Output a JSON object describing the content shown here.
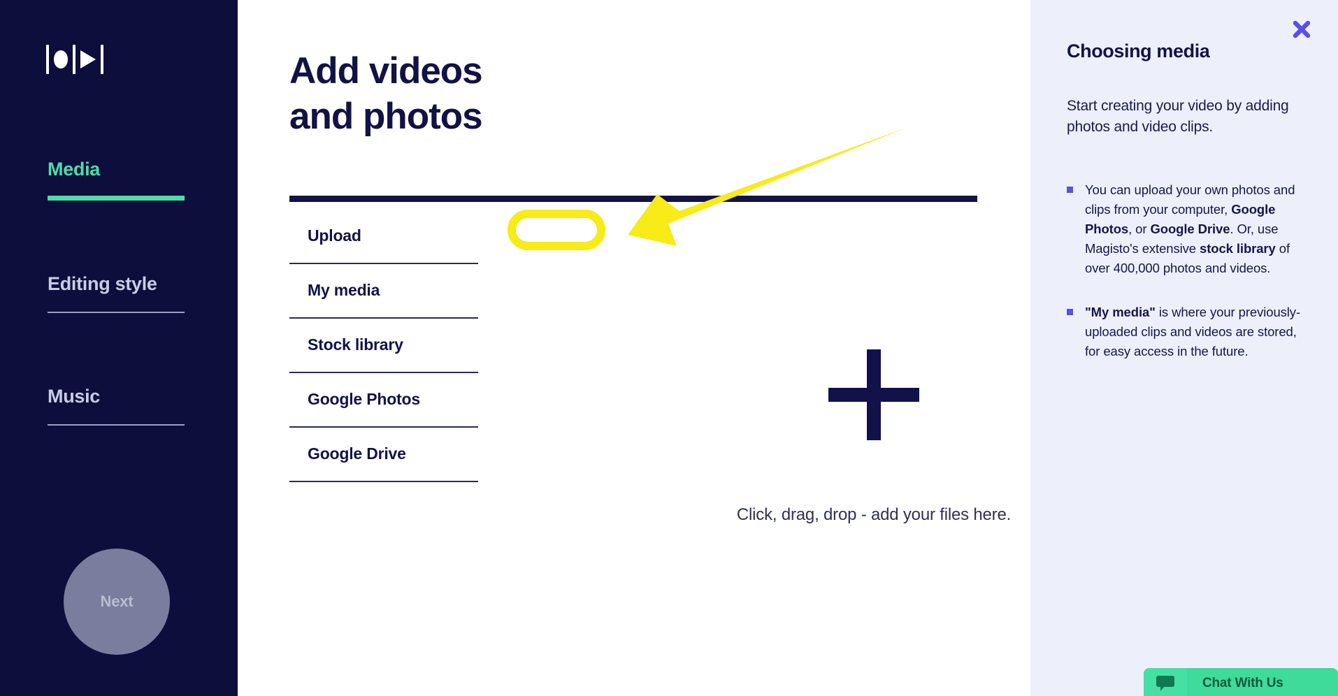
{
  "sidebar": {
    "logo": {
      "icon": "magisto-play-logo",
      "parts": [
        "bar",
        "circle",
        "bar",
        "play-triangle",
        "bar"
      ]
    },
    "items": [
      {
        "id": "media",
        "label": "Media",
        "active": true
      },
      {
        "id": "editing-style",
        "label": "Editing style",
        "active": false
      },
      {
        "id": "music",
        "label": "Music",
        "active": false
      }
    ],
    "next_button": {
      "label": "Next",
      "enabled": false
    }
  },
  "main": {
    "title": "Add videos\nand photos",
    "sources": [
      {
        "id": "upload",
        "label": "Upload",
        "highlighted": true
      },
      {
        "id": "my-media",
        "label": "My media",
        "highlighted": false
      },
      {
        "id": "stock-library",
        "label": "Stock library",
        "highlighted": false
      },
      {
        "id": "google-photos",
        "label": "Google Photos",
        "highlighted": false
      },
      {
        "id": "google-drive",
        "label": "Google Drive",
        "highlighted": false
      }
    ],
    "dropzone": {
      "icon": "plus-icon",
      "text": "Click, drag, drop - add your files here."
    },
    "annotation": {
      "arrow_color": "#F7EB18",
      "highlight_color": "#F7EB18",
      "target": "Upload"
    }
  },
  "help_panel": {
    "close_icon": "close-icon",
    "title": "Choosing media",
    "intro": "Start creating your video by adding photos and video clips.",
    "bullets": [
      {
        "segments": [
          {
            "text": "You can upload your own photos and clips from your computer, ",
            "bold": false
          },
          {
            "text": "Google Photos",
            "bold": true
          },
          {
            "text": ", or ",
            "bold": false
          },
          {
            "text": "Google Drive",
            "bold": true
          },
          {
            "text": ". Or, use Magisto's extensive ",
            "bold": false
          },
          {
            "text": "stock library",
            "bold": true
          },
          {
            "text": " of over 400,000 photos and videos.",
            "bold": false
          }
        ]
      },
      {
        "segments": [
          {
            "text": "\"My media\"",
            "bold": true
          },
          {
            "text": " is where your previously-uploaded clips and videos are stored, for easy access in the future.",
            "bold": false
          }
        ]
      }
    ]
  },
  "chat_widget": {
    "icon": "chat-bubble-icon",
    "label": "Chat With Us"
  },
  "colors": {
    "sidebar_bg": "#0E0E3C",
    "accent_green": "#4FDCA8",
    "panel_bg": "#EDF0FA",
    "text_dark": "#13134A",
    "purple": "#5A4FE8",
    "annotation_yellow": "#F7EB18",
    "chat_green": "#3FDB9A"
  }
}
